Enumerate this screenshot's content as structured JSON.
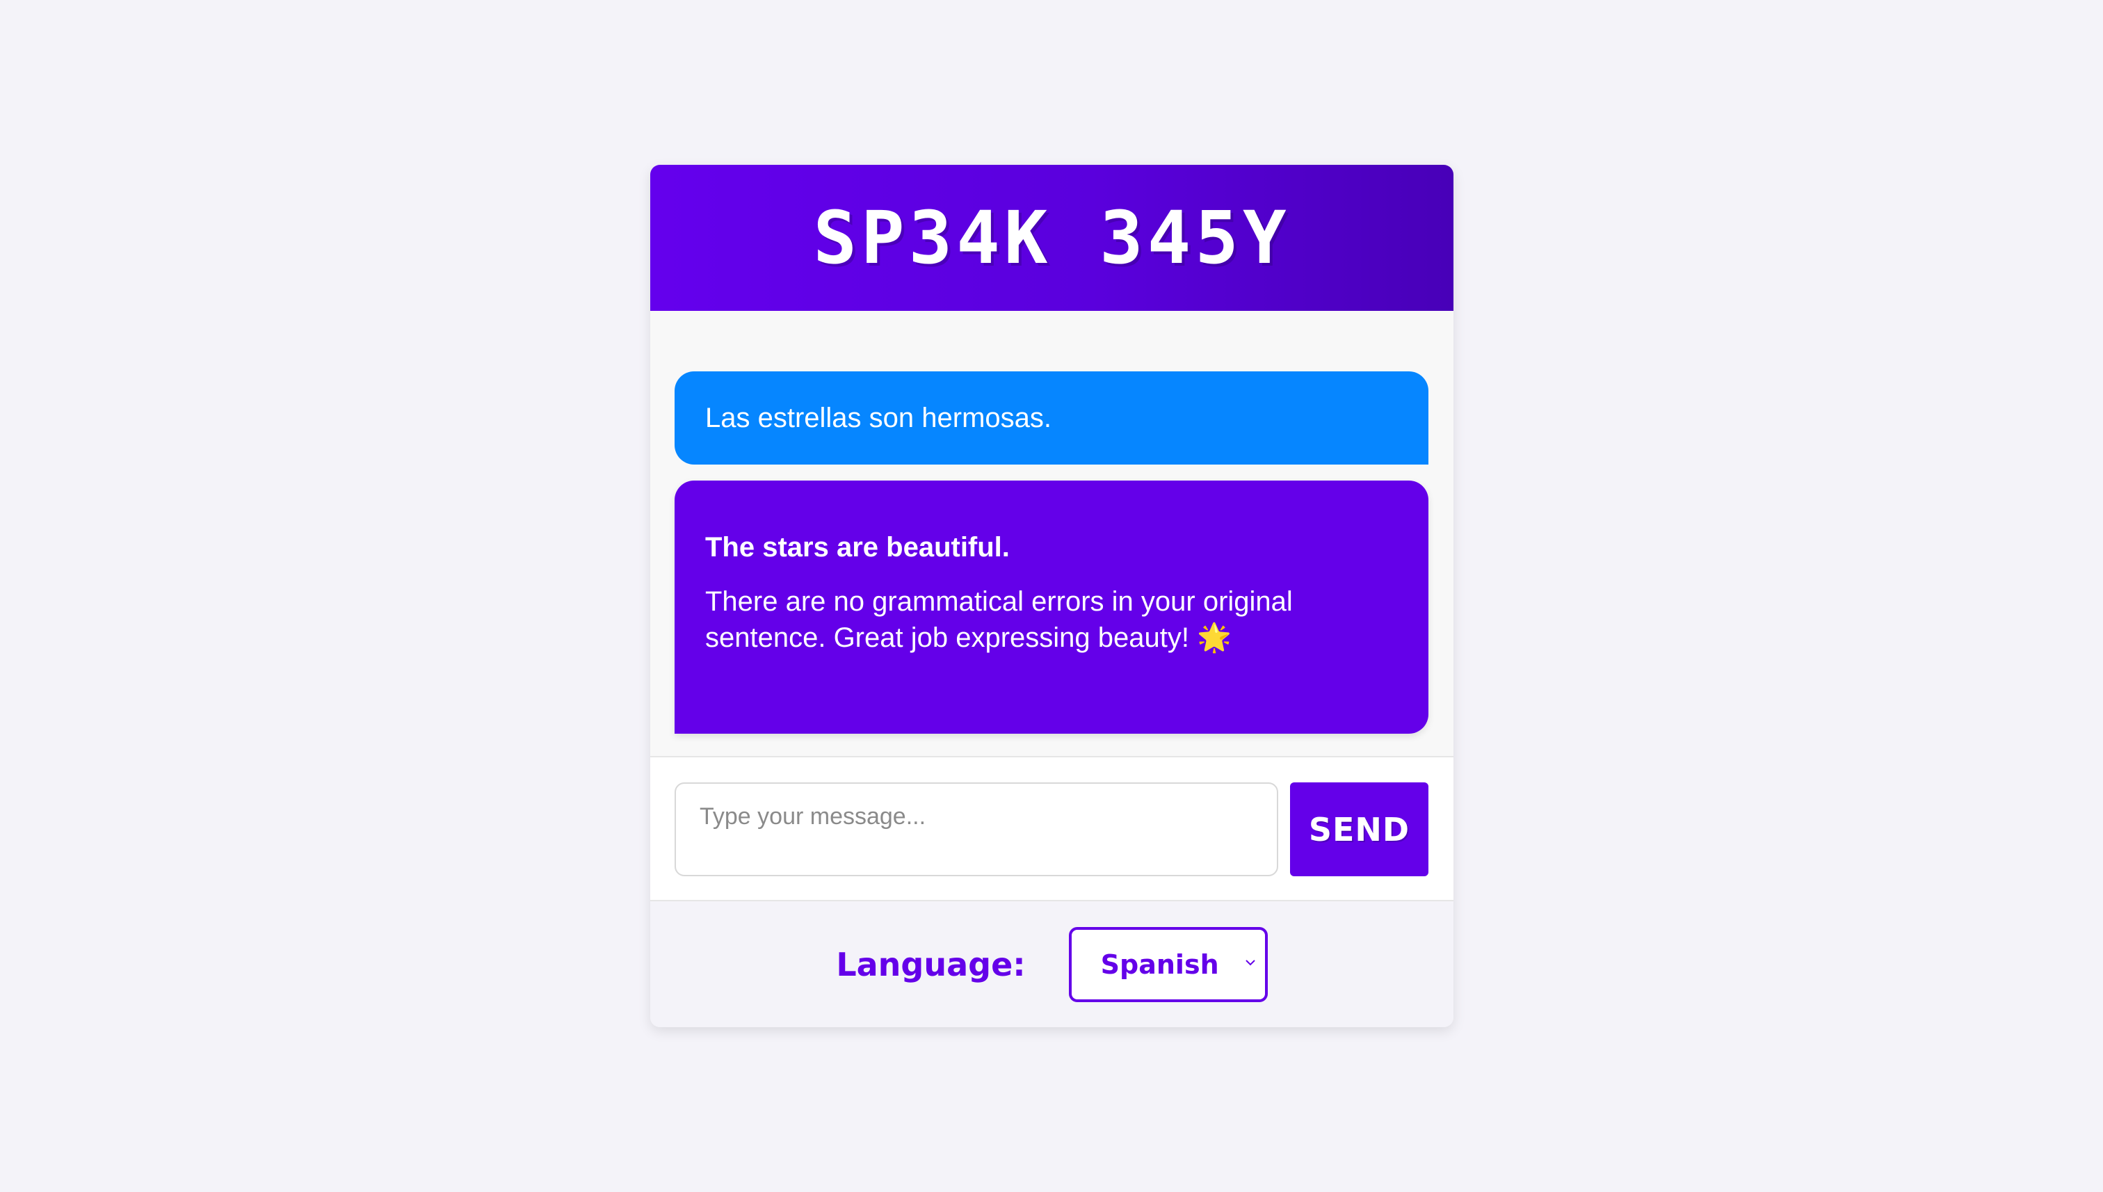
{
  "app": {
    "title": "SP34K 345Y"
  },
  "messages": {
    "user": {
      "text": "Las estrellas son hermosas."
    },
    "bot": {
      "title": "The stars are beautiful.",
      "body": "There are no grammatical errors in your original sentence. Great job expressing beauty! 🌟"
    }
  },
  "input": {
    "placeholder": "Type your message...",
    "value": ""
  },
  "send_button": {
    "label": "SEND"
  },
  "language": {
    "label": "Language:",
    "selected": "Spanish",
    "selector_icon": "chevron-down-icon"
  },
  "colors": {
    "primary": "#6400e9",
    "user_bubble": "#0686ff",
    "background": "#f4f3f9"
  }
}
